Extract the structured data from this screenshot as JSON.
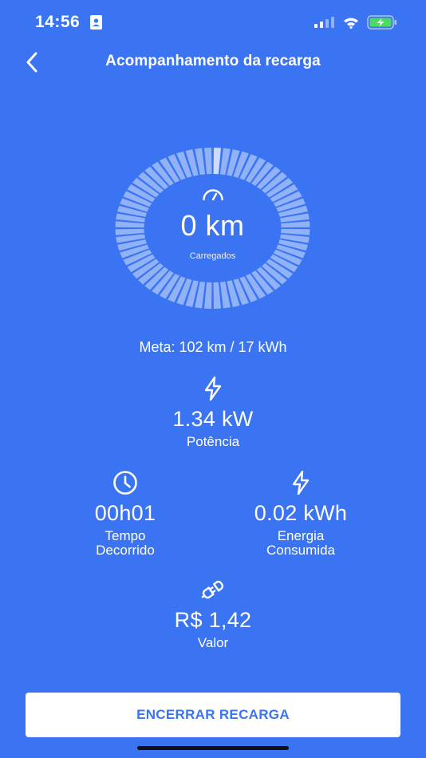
{
  "status_bar": {
    "time": "14:56",
    "icons": [
      "contact-card-icon",
      "cellular-signal-icon",
      "wifi-icon",
      "battery-charging-icon"
    ]
  },
  "header": {
    "title": "Acompanhamento da recarga",
    "back_icon": "chevron-left-icon"
  },
  "gauge": {
    "icon": "speedometer-icon",
    "value": "0 km",
    "label": "Carregados",
    "progress": 0
  },
  "goal": "Meta: 102 km / 17 kWh",
  "stats": {
    "power": {
      "icon": "lightning-icon",
      "value": "1.34 kW",
      "label": "Potência"
    },
    "elapsed": {
      "icon": "clock-icon",
      "value": "00h01",
      "label_line1": "Tempo",
      "label_line2": "Decorrido"
    },
    "energy": {
      "icon": "lightning-icon",
      "value": "0.02 kWh",
      "label_line1": "Energia",
      "label_line2": "Consumida"
    },
    "price": {
      "icon": "plug-icon",
      "value": "R$ 1,42",
      "label": "Valor"
    }
  },
  "actions": {
    "end_label": "ENCERRAR RECARGA"
  },
  "colors": {
    "background": "#3a74f2",
    "text": "#ffffff",
    "button_text": "#3a74f2",
    "battery_fill": "#4cd964"
  }
}
